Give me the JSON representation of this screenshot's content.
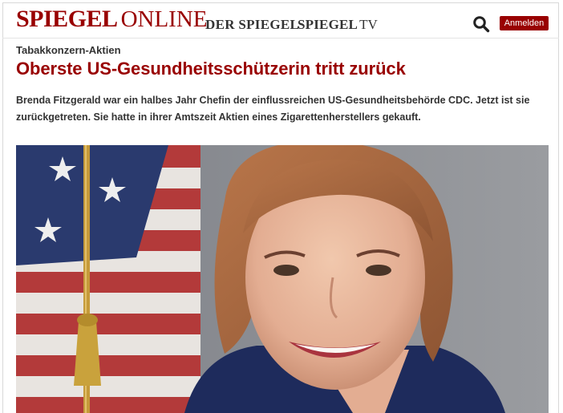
{
  "header": {
    "logo_main": "SPIEGEL",
    "logo_sub": "ONLINE",
    "nav": {
      "der_spiegel": "DER SPIEGEL",
      "spiegel_tv_main": "SPIEGEL",
      "spiegel_tv_sub": "TV"
    },
    "search_icon": "search-icon",
    "login_label": "Anmelden"
  },
  "article": {
    "kicker": "Tabakkonzern-Aktien",
    "headline": "Oberste US-Gesundheitsschützerin tritt zurück",
    "teaser": "Brenda Fitzgerald war ein halbes Jahr Chefin der einflussreichen US-Gesundheitsbehörde CDC. Jetzt ist sie zurückgetreten. Sie hatte in ihrer Amtszeit Aktien eines Zigarettenherstellers gekauft."
  },
  "colors": {
    "brand": "#990000",
    "text": "#333333",
    "button_text": "#ffffff"
  }
}
